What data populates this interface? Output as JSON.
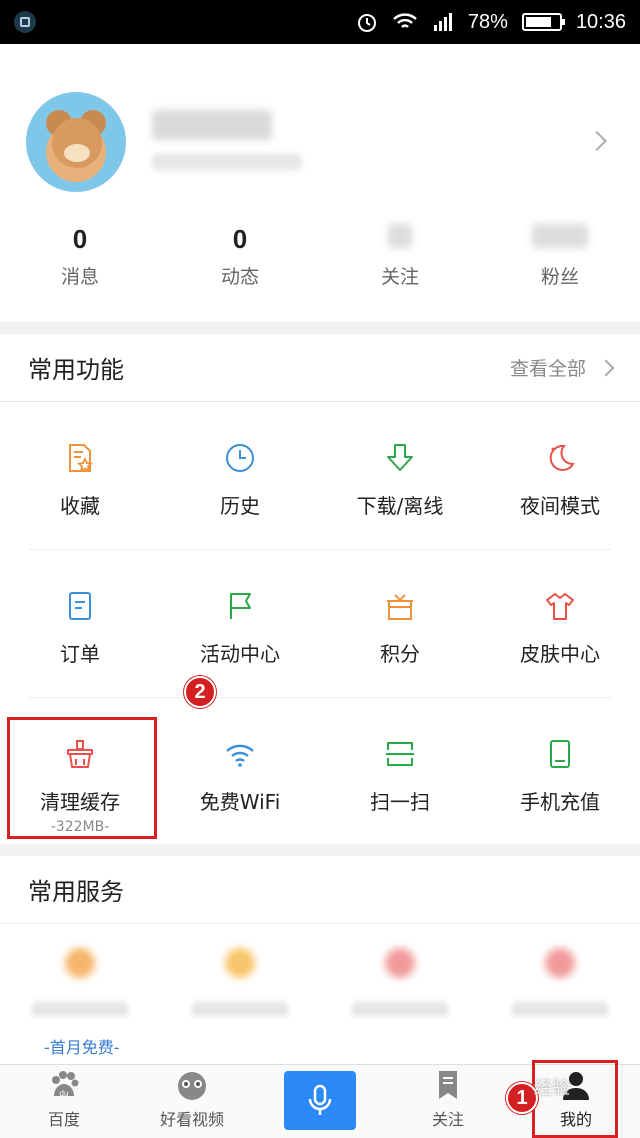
{
  "status_bar": {
    "battery": "78%",
    "battery_level": 0.78,
    "time": "10:36"
  },
  "profile": {
    "stats": [
      {
        "value": "0",
        "label": "消息",
        "blurred": false
      },
      {
        "value": "0",
        "label": "动态",
        "blurred": false
      },
      {
        "value": "",
        "label": "关注",
        "blurred": true
      },
      {
        "value": "",
        "label": "粉丝",
        "blurred": true
      }
    ]
  },
  "common_functions": {
    "title": "常用功能",
    "view_all": "查看全部",
    "items": [
      {
        "label": "收藏",
        "icon": "favorite-icon",
        "color": "#f0923b"
      },
      {
        "label": "历史",
        "icon": "history-clock-icon",
        "color": "#3a8fd9"
      },
      {
        "label": "下载/离线",
        "icon": "download-icon",
        "color": "#2aa84a"
      },
      {
        "label": "夜间模式",
        "icon": "night-mode-icon",
        "color": "#e8504a"
      },
      {
        "label": "订单",
        "icon": "order-icon",
        "color": "#3a8fd9"
      },
      {
        "label": "活动中心",
        "icon": "flag-icon",
        "color": "#2aa84a"
      },
      {
        "label": "积分",
        "icon": "gift-icon",
        "color": "#f0923b"
      },
      {
        "label": "皮肤中心",
        "icon": "shirt-icon",
        "color": "#e8504a"
      },
      {
        "label": "清理缓存",
        "icon": "clean-cache-icon",
        "color": "#e8504a",
        "sub": "-322MB-"
      },
      {
        "label": "免费WiFi",
        "icon": "wifi-icon",
        "color": "#3a8fd9"
      },
      {
        "label": "扫一扫",
        "icon": "scan-icon",
        "color": "#2aa84a"
      },
      {
        "label": "手机充值",
        "icon": "phone-recharge-icon",
        "color": "#2aa84a"
      }
    ]
  },
  "common_services": {
    "title": "常用服务",
    "promo": "-首月免费-",
    "dot_colors": [
      "#f7b56a",
      "#f7c56a",
      "#f19a9a",
      "#f19a9a"
    ]
  },
  "tabbar": {
    "items": [
      {
        "label": "百度",
        "icon": "baidu-paw-icon"
      },
      {
        "label": "好看视频",
        "icon": "video-face-icon"
      },
      {
        "label": "",
        "icon": "microphone-icon"
      },
      {
        "label": "关注",
        "icon": "bookmark-icon"
      },
      {
        "label": "我的",
        "icon": "user-icon"
      }
    ]
  },
  "annotations": {
    "badge_1": "1",
    "badge_2": "2",
    "watermark": "经验"
  }
}
